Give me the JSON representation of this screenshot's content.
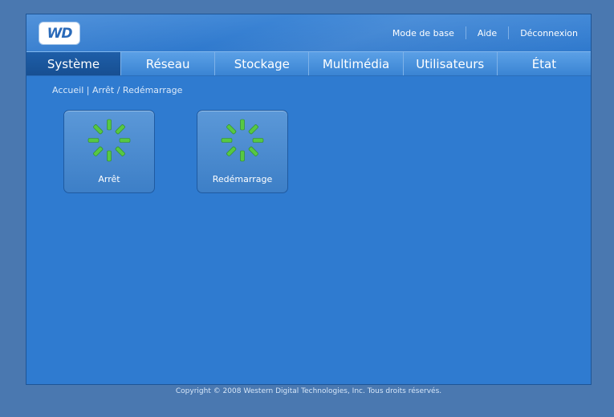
{
  "header": {
    "logo_text": "WD",
    "links": [
      "Mode de base",
      "Aide",
      "Déconnexion"
    ]
  },
  "tabs": [
    {
      "label": "Système",
      "active": true
    },
    {
      "label": "Réseau",
      "active": false
    },
    {
      "label": "Stockage",
      "active": false
    },
    {
      "label": "Multimédia",
      "active": false
    },
    {
      "label": "Utilisateurs",
      "active": false
    },
    {
      "label": "État",
      "active": false
    }
  ],
  "breadcrumb": {
    "home": "Accueil",
    "separator": "|",
    "current": "Arrêt / Redémarrage"
  },
  "cards": [
    {
      "label": "Arrêt",
      "icon": "spinner-icon"
    },
    {
      "label": "Redémarrage",
      "icon": "spinner-icon"
    }
  ],
  "footer": {
    "copyright": "Copyright © 2008 Western Digital Technologies, Inc. Tous droits réservés."
  },
  "colors": {
    "background": "#4a78b0",
    "panel": "#2f7bd0",
    "active_tab": "#1e5ea8",
    "spinner_green": "#57c843"
  }
}
